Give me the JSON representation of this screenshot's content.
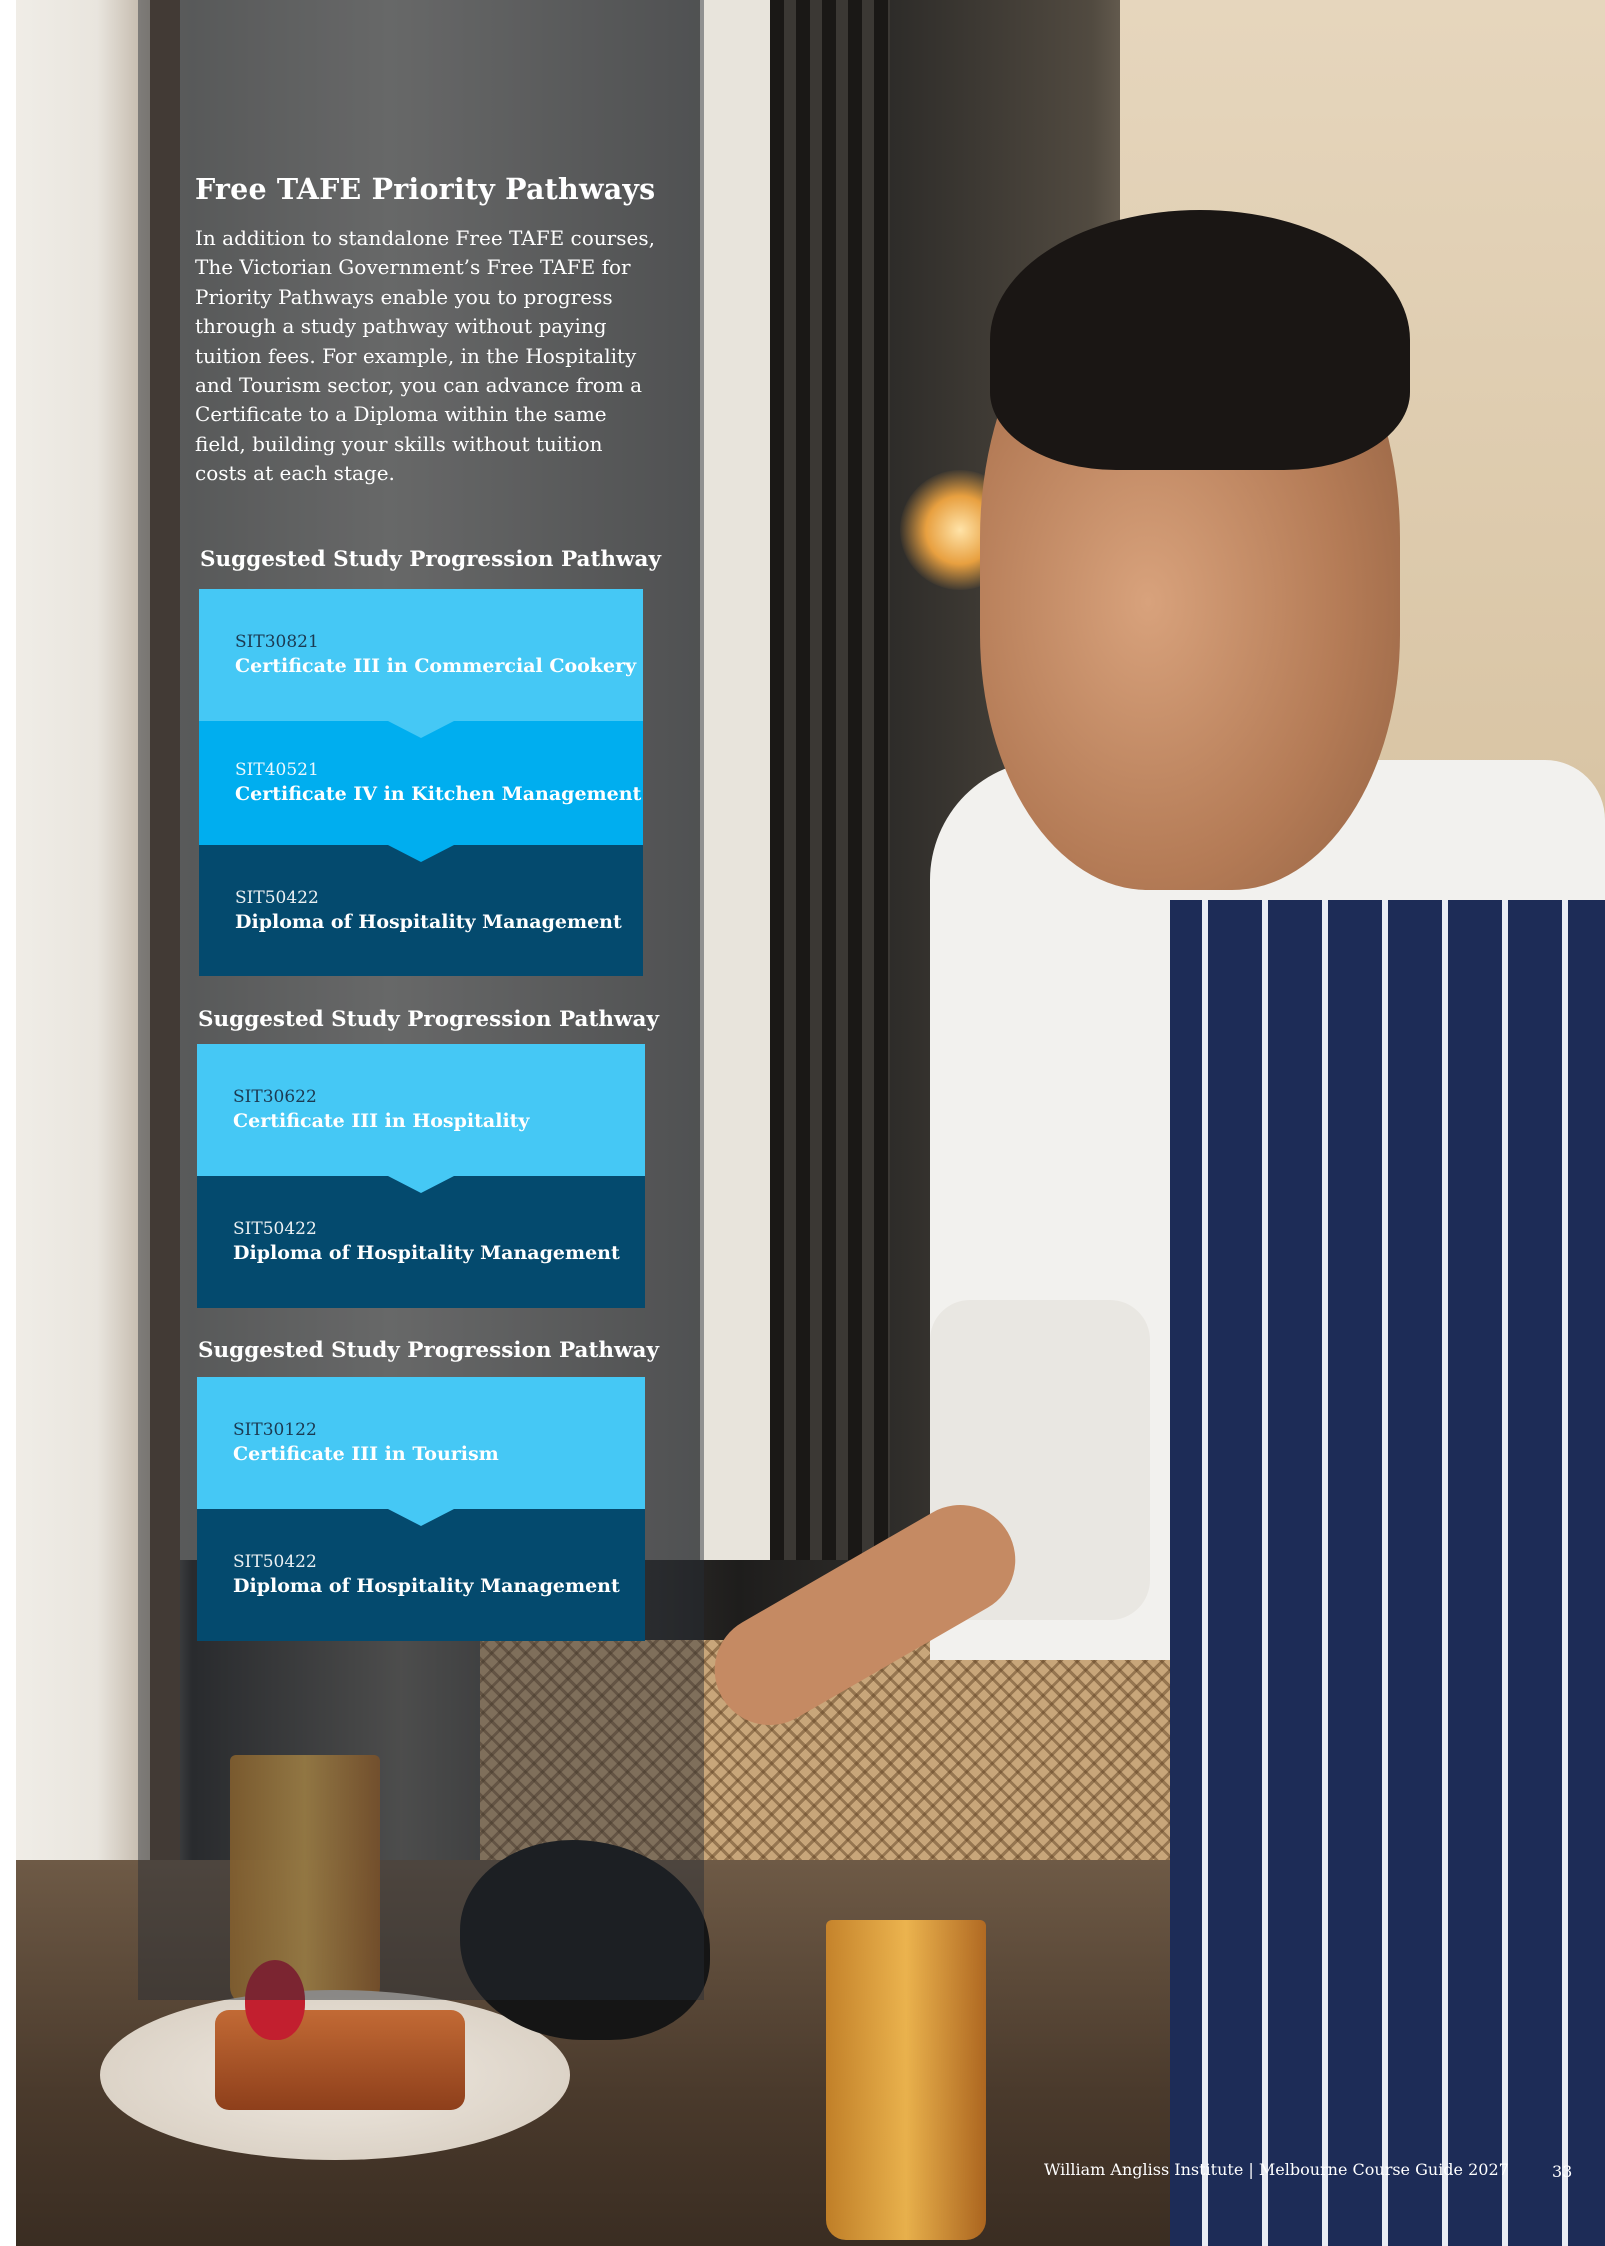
{
  "intro": {
    "title": "Free TAFE Priority Pathways",
    "text": "In addition to standalone Free TAFE courses, The Victorian Government’s Free TAFE for Priority Pathways enable you to progress through a study pathway without paying tuition fees. For example, in the Hospitality and Tourism sector, you can advance from a Certificate to a Diploma within the same field, building your skills without tuition costs at each stage."
  },
  "pathways": [
    {
      "heading": "Suggested Study Progression Pathway",
      "steps": [
        {
          "code": "SIT30821",
          "name": "Certificate III in Commercial Cookery"
        },
        {
          "code": "SIT40521",
          "name": "Certificate IV in Kitchen Management"
        },
        {
          "code": "SIT50422",
          "name": "Diploma of Hospitality Management"
        }
      ]
    },
    {
      "heading": "Suggested Study Progression Pathway",
      "steps": [
        {
          "code": "SIT30622",
          "name": "Certificate III in Hospitality"
        },
        {
          "code": "SIT50422",
          "name": "Diploma of Hospitality Management"
        }
      ]
    },
    {
      "heading": "Suggested Study Progression Pathway",
      "steps": [
        {
          "code": "SIT30122",
          "name": "Certificate III in Tourism"
        },
        {
          "code": "SIT50422",
          "name": "Diploma of Hospitality Management"
        }
      ]
    }
  ],
  "footer": {
    "text": "William Angliss Institute | Melbourne Course Guide 2027",
    "page_number": "33"
  },
  "colors": {
    "light_blue": "#45c8f5",
    "mid_blue": "#00aeef",
    "dark_blue": "#044a6e"
  }
}
